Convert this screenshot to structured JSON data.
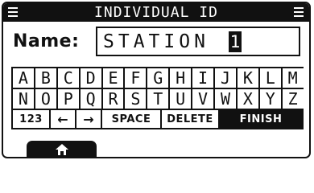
{
  "header": {
    "title": "INDIVIDUAL ID",
    "left_icon": "menu-icon",
    "right_icon": "menu-icon"
  },
  "name_field": {
    "label": "Name:",
    "value": "STATION",
    "cursor_char": "1"
  },
  "keyboard": {
    "row1": [
      "A",
      "B",
      "C",
      "D",
      "E",
      "F",
      "G",
      "H",
      "I",
      "J",
      "K",
      "L",
      "M"
    ],
    "row2": [
      "N",
      "O",
      "P",
      "Q",
      "R",
      "S",
      "T",
      "U",
      "V",
      "W",
      "X",
      "Y",
      "Z"
    ],
    "row3": {
      "numeric": "123",
      "left_arrow": "←",
      "right_arrow": "→",
      "space": "SPACE",
      "delete": "DELETE",
      "finish": "FINISH"
    }
  },
  "footer": {
    "home_icon": "home-icon"
  }
}
